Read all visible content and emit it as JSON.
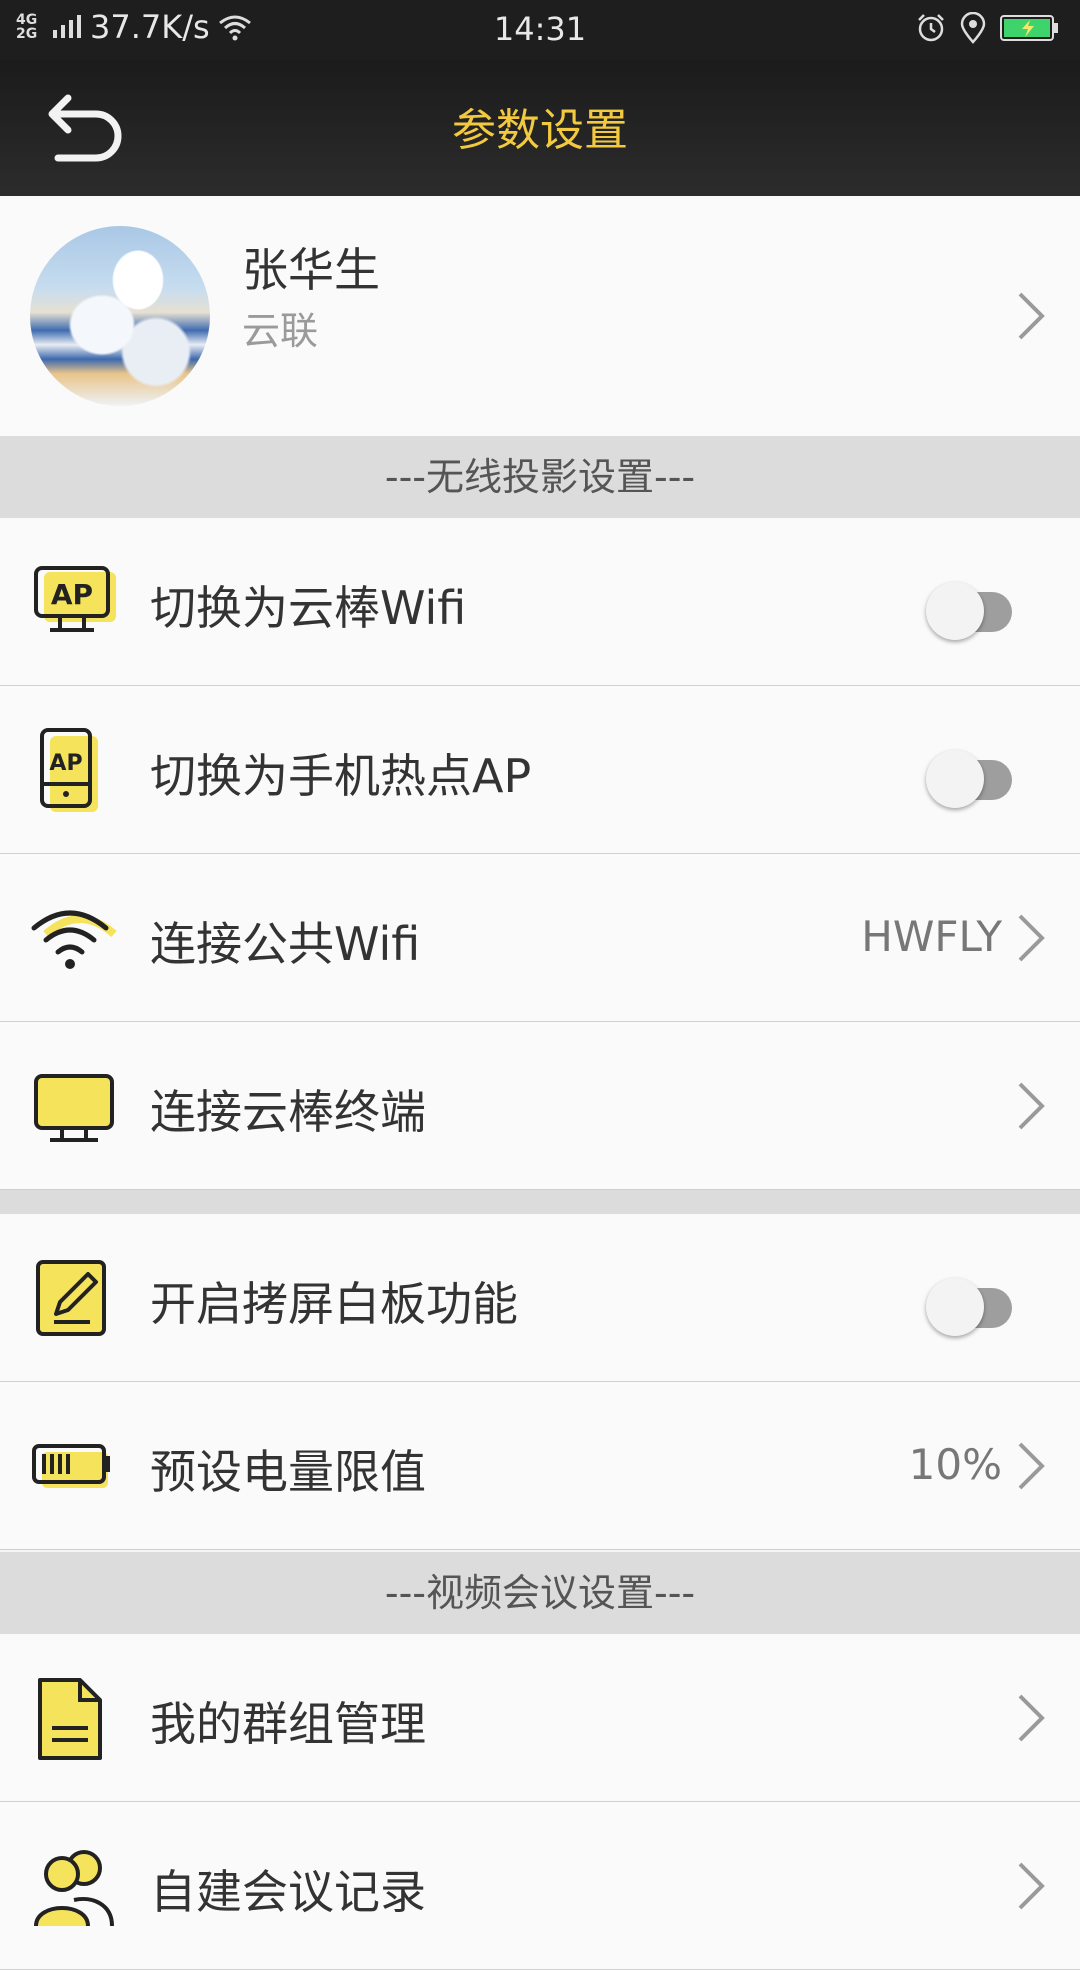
{
  "status_bar": {
    "network": "4G\n2G",
    "speed": "37.7K/s",
    "time": "14:31"
  },
  "header": {
    "title": "参数设置"
  },
  "profile": {
    "name": "张华生",
    "org": "云联"
  },
  "sections": {
    "wireless": "---无线投影设置---",
    "video": "---视频会议设置---"
  },
  "rows": [
    {
      "label": "切换为云棒Wifi",
      "icon": "ap-monitor-icon",
      "toggle": false
    },
    {
      "label": "切换为手机热点AP",
      "icon": "phone-ap-icon",
      "toggle": false
    },
    {
      "label": "连接公共Wifi",
      "icon": "wifi-icon",
      "value": "HWFLY"
    },
    {
      "label": "连接云棒终端",
      "icon": "monitor-icon"
    },
    {
      "label": "开启拷屏白板功能",
      "icon": "whiteboard-edit-icon",
      "toggle": false
    },
    {
      "label": "预设电量限值",
      "icon": "battery-icon",
      "value": "10%"
    },
    {
      "label": "我的群组管理",
      "icon": "document-icon"
    },
    {
      "label": "自建会议记录",
      "icon": "group-users-icon"
    }
  ],
  "colors": {
    "accent": "#f3c93f",
    "header_bg": "#1e1e1e",
    "icon_yellow": "#f6e35c",
    "section_bg": "#dcdcdc"
  }
}
